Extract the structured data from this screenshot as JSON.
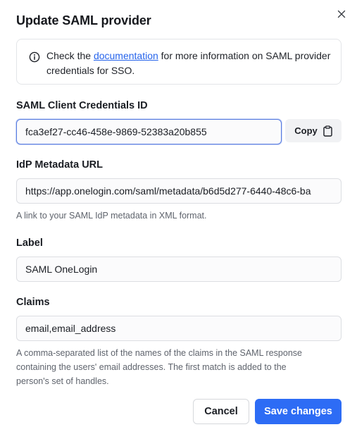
{
  "dialog": {
    "title": "Update SAML provider",
    "close_icon": "close-icon"
  },
  "info": {
    "icon": "info-icon",
    "text_before": "Check the ",
    "link_text": "documentation",
    "text_after": " for more information on SAML provider credentials for SSO."
  },
  "client_id": {
    "label": "SAML Client Credentials ID",
    "value": "fca3ef27-cc46-458e-9869-52383a20b855",
    "copy_label": "Copy",
    "copy_icon": "clipboard-icon"
  },
  "metadata_url": {
    "label": "IdP Metadata URL",
    "value": "https://app.onelogin.com/saml/metadata/b6d5d277-6440-48c6-ba",
    "help": "A link to your SAML IdP metadata in XML format."
  },
  "label_field": {
    "label": "Label",
    "value": "SAML OneLogin"
  },
  "claims": {
    "label": "Claims",
    "value": "email,email_address",
    "help_line1": "A comma-separated list of the names of the claims in the SAML response",
    "help_line2": "containing the users' email addresses. The first match is added to the",
    "help_line3": "person's set of handles."
  },
  "actions": {
    "cancel_label": "Cancel",
    "save_label": "Save changes"
  },
  "colors": {
    "primary": "#2d6cf5",
    "link": "#2563eb",
    "focus_border": "#5a7de0"
  }
}
